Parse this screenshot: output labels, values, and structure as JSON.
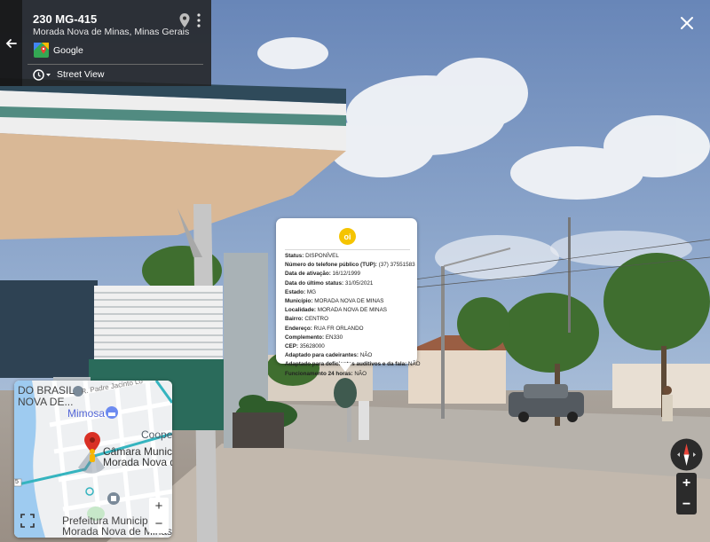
{
  "location": {
    "title": "230 MG-415",
    "subtitle": "Morada Nova de Minas, Minas Gerais",
    "provider": "Google",
    "mode_label": "Street View"
  },
  "icons": {
    "back": "arrow-left-icon",
    "pin": "map-pin-icon",
    "more": "more-vert-icon",
    "close": "close-icon",
    "history": "history-icon",
    "fullscreen": "fullscreen-icon",
    "compass": "compass-icon",
    "oi_logo": "oi-logo"
  },
  "popup": {
    "fields": [
      {
        "label": "Status:",
        "value": "DISPONÍVEL"
      },
      {
        "label": "Número do telefone público (TUP):",
        "value": "(37) 37551583"
      },
      {
        "label": "Data de ativação:",
        "value": "16/12/1999"
      },
      {
        "label": "Data do último status:",
        "value": "31/05/2021"
      },
      {
        "label": "Estado:",
        "value": "MG"
      },
      {
        "label": "Município:",
        "value": "MORADA NOVA DE MINAS"
      },
      {
        "label": "Localidade:",
        "value": "MORADA NOVA DE MINAS"
      },
      {
        "label": "Bairro:",
        "value": "CENTRO"
      },
      {
        "label": "Endereço:",
        "value": "RUA FR ORLANDO"
      },
      {
        "label": "Complemento:",
        "value": "EN330"
      },
      {
        "label": "CEP:",
        "value": "35628000"
      },
      {
        "label": "Adaptado para cadeirantes:",
        "value": "NÃO"
      },
      {
        "label": "Adaptado para deficientes auditivos e da fala:",
        "value": "NÃO"
      },
      {
        "label": "Funcionamento 24 horas:",
        "value": "NÃO"
      }
    ],
    "logo_text": "oi"
  },
  "minimap": {
    "labels": {
      "brasil": "DO BRASIL",
      "nova_de": "NOVA DE...",
      "street": "R. Padre Jacinto Lo",
      "mimosa": "Mimosa",
      "coope": "Coope",
      "camara1": "Câmara Municip",
      "camara2": "Morada Nova de",
      "prefeitura1": "Prefeitura Municip",
      "prefeitura2": "Morada Nova de Minas",
      "road_badge": "5"
    },
    "zoom_in": "+",
    "zoom_out": "−"
  },
  "controls": {
    "zoom_in": "+",
    "zoom_out": "−"
  },
  "colors": {
    "panel_bg": "#222222",
    "oi_yellow": "#f5c400",
    "map_water": "#9ecbf0",
    "map_road_teal": "#35b4bf",
    "marker_red": "#d93025",
    "pegman_yellow": "#f7b500"
  }
}
